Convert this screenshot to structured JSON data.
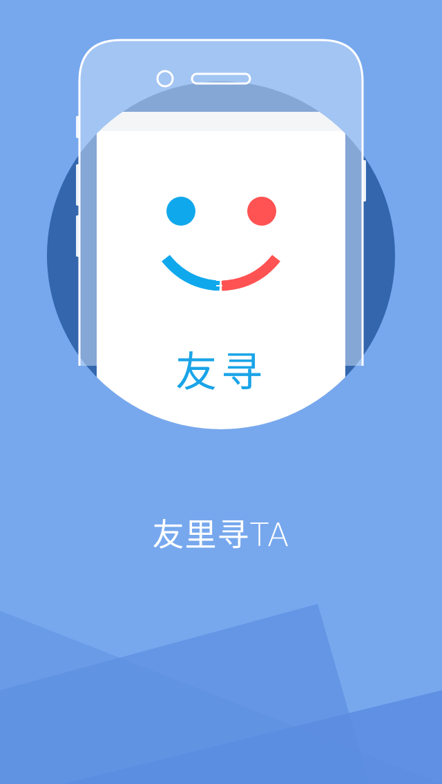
{
  "splash": {
    "app_name": "友寻",
    "tagline": "友里寻TA"
  },
  "colors": {
    "background": "#77a8ee",
    "circle": "#3366ad",
    "phone_outline": "#ffffff",
    "left_eye": "#10a8ec",
    "right_eye": "#ff5252",
    "app_name_text": "#1aa4e8",
    "tagline_text": "#ffffff"
  },
  "icons": {
    "logo": "smiley-face-icon"
  }
}
